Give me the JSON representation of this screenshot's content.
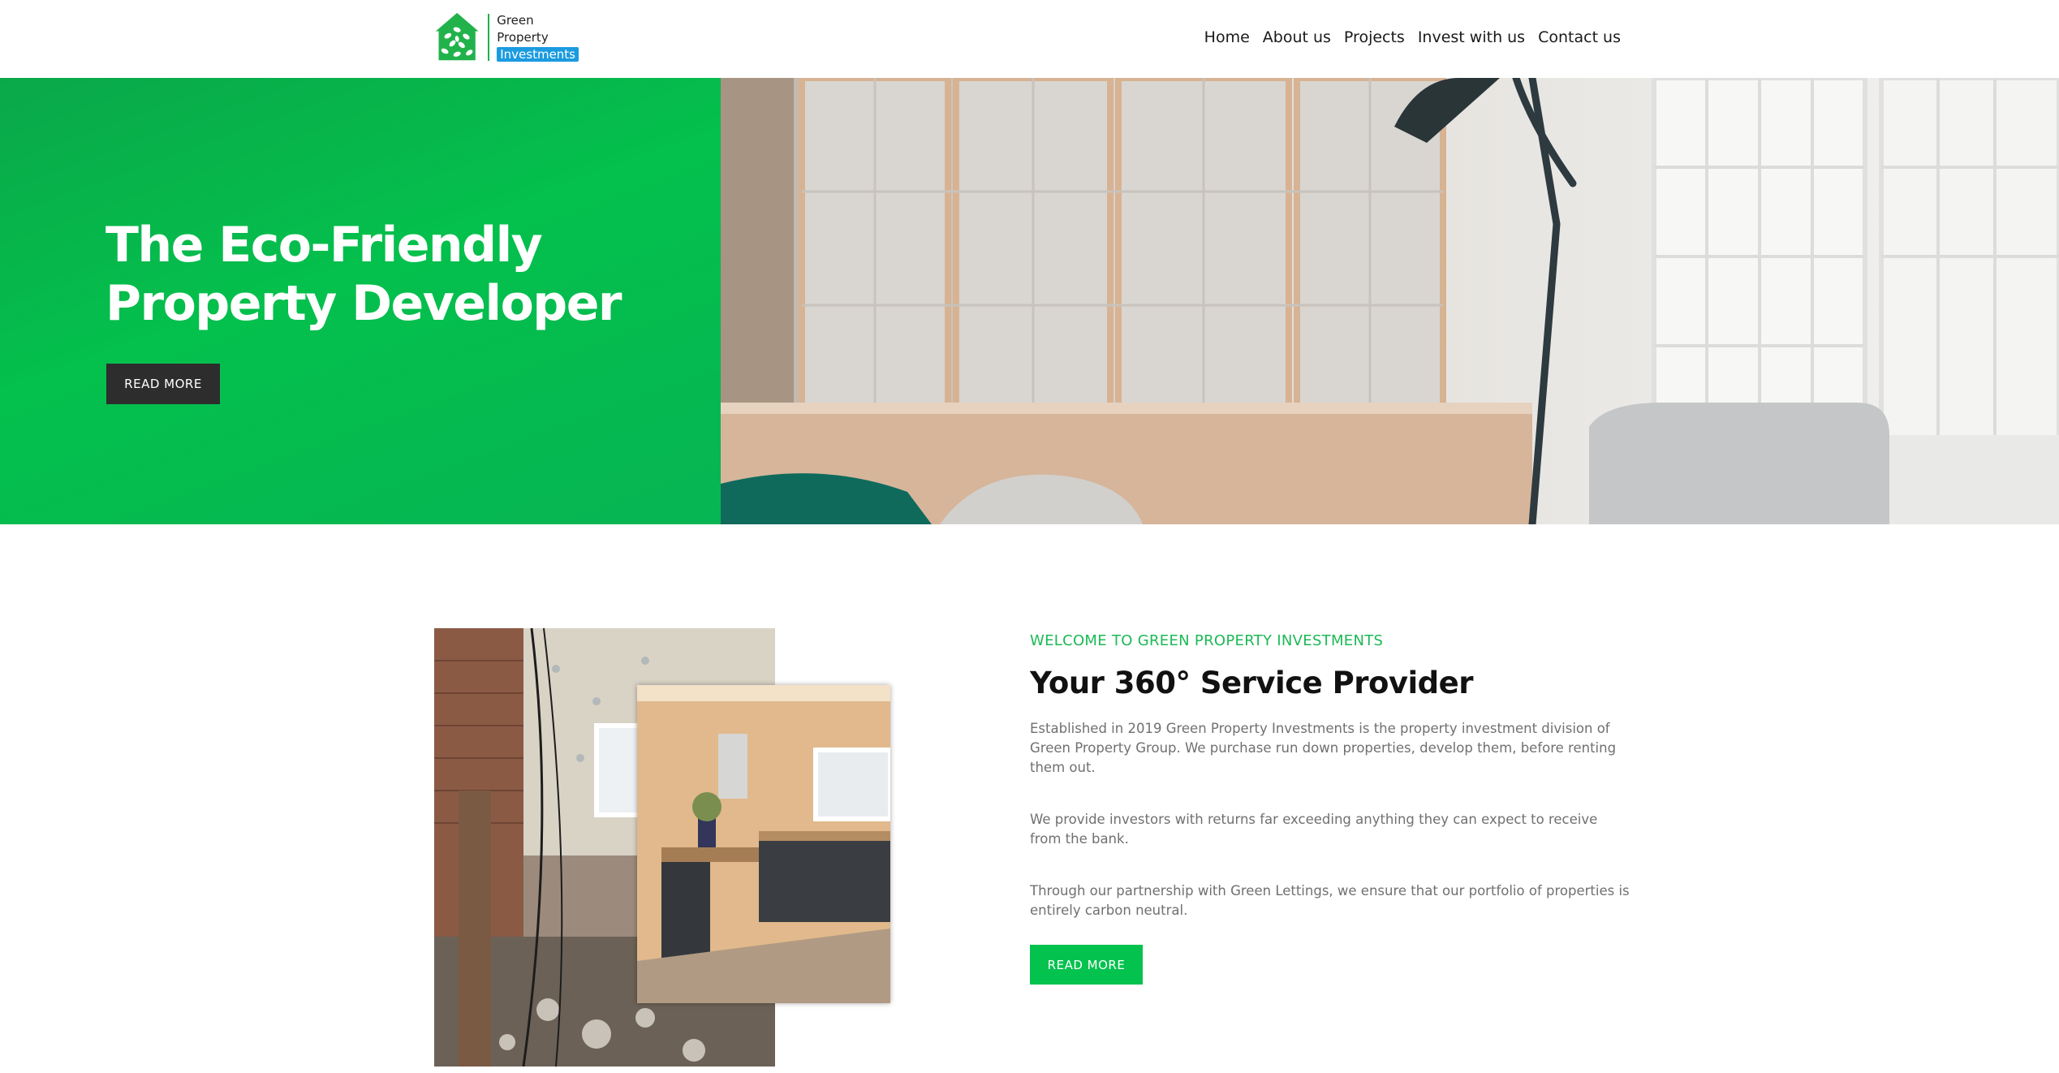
{
  "brand": {
    "line1": "Green",
    "line2": "Property",
    "badge": "Investments",
    "accent": "#04c24e",
    "badge_color": "#1b9be0"
  },
  "nav": {
    "items": [
      {
        "label": "Home"
      },
      {
        "label": "About us"
      },
      {
        "label": "Projects"
      },
      {
        "label": "Invest with us"
      },
      {
        "label": "Contact us"
      }
    ]
  },
  "hero": {
    "title": "The Eco-Friendly Property Developer",
    "button": "READ MORE"
  },
  "about": {
    "eyebrow": "WELCOME TO GREEN PROPERTY INVESTMENTS",
    "heading": "Your 360° Service Provider",
    "paragraphs": [
      "Established in 2019 Green Property Investments is the property investment division of Green Property Group. We purchase run down properties, develop them, before renting them out.",
      "We provide investors with returns far exceeding anything they can expect to receive from the bank.",
      "Through our partnership with Green Lettings, we ensure that our portfolio of properties is entirely carbon neutral."
    ],
    "button": "READ MORE"
  }
}
